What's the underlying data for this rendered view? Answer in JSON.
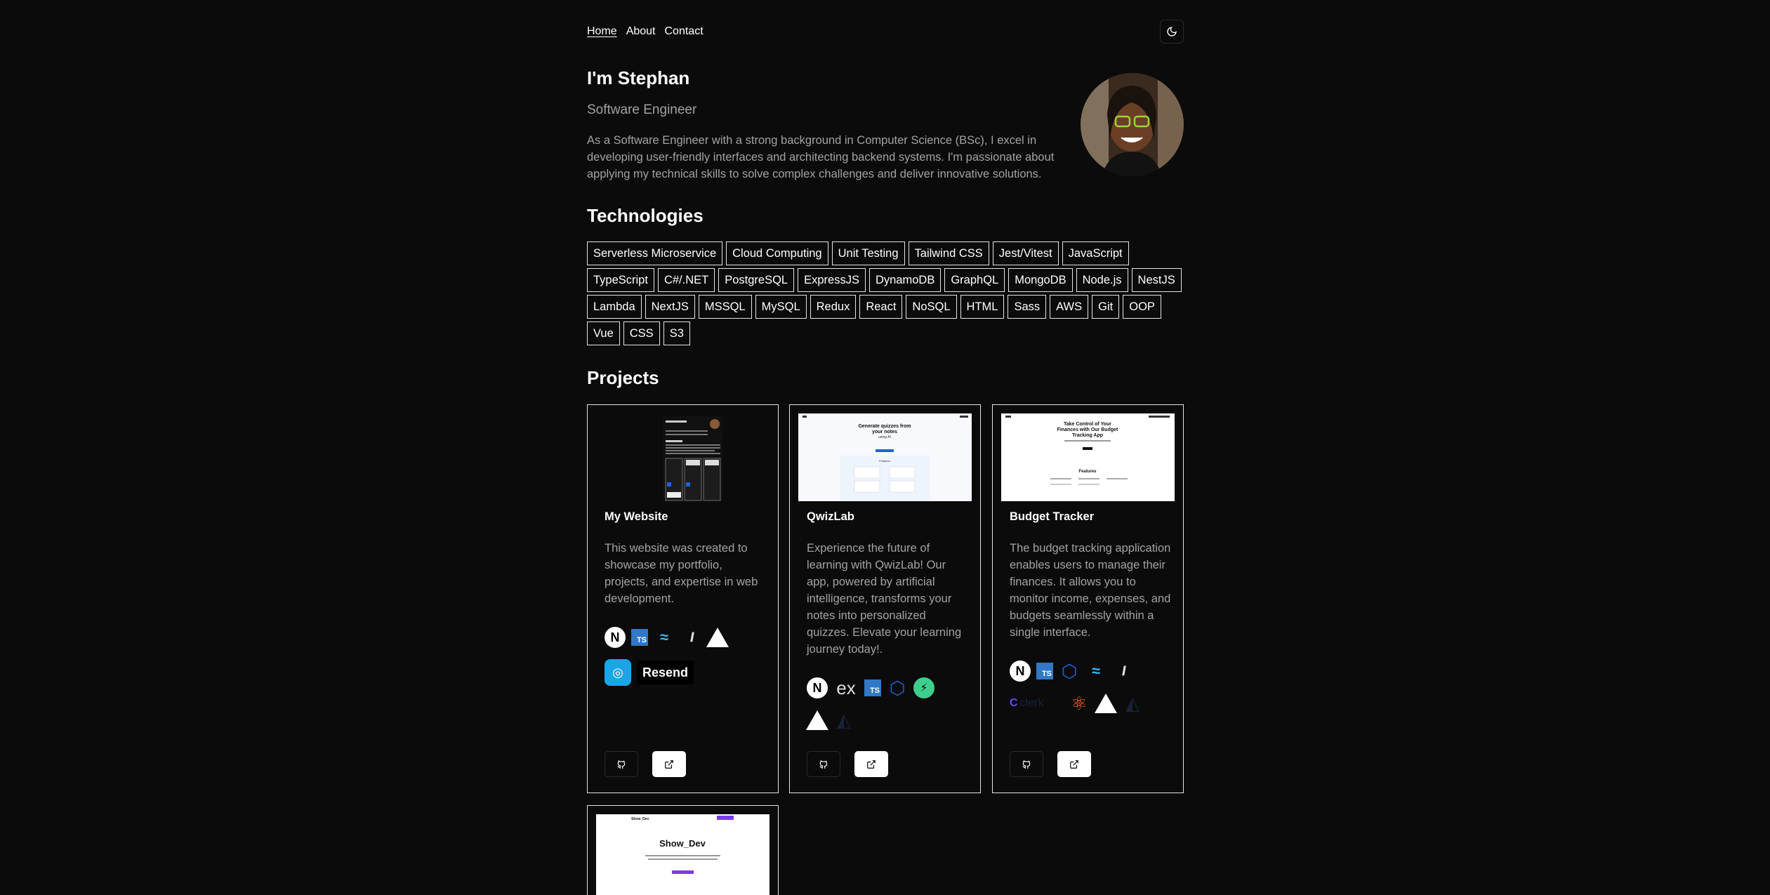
{
  "nav": {
    "items": [
      "Home",
      "About",
      "Contact"
    ]
  },
  "theme_toggle": {
    "icon": "moon-icon"
  },
  "hero": {
    "name": "I'm Stephan",
    "role": "Software Engineer",
    "bio": "As a Software Engineer with a strong background in Computer Science (BSc), I excel in developing user-friendly interfaces and architecting backend systems. I'm passionate about applying my technical skills to solve complex challenges and deliver innovative solutions."
  },
  "technologies": {
    "title": "Technologies",
    "tags": [
      "Serverless Microservice",
      "Cloud Computing",
      "Unit Testing",
      "Tailwind CSS",
      "Jest/Vitest",
      "JavaScript",
      "TypeScript",
      "C#/.NET",
      "PostgreSQL",
      "ExpressJS",
      "DynamoDB",
      "GraphQL",
      "MongoDB",
      "Node.js",
      "NestJS",
      "Lambda",
      "NextJS",
      "MSSQL",
      "MySQL",
      "Redux",
      "React",
      "NoSQL",
      "HTML",
      "Sass",
      "AWS",
      "Git",
      "OOP",
      "Vue",
      "CSS",
      "S3"
    ]
  },
  "projects": {
    "title": "Projects",
    "cards": [
      {
        "title": "My Website",
        "description": "This website was created to showcase my portfolio, projects, and expertise in web development.",
        "stack_icons": [
          "nextjs-icon",
          "typescript-icon",
          "tailwind-icon",
          "shadcn-icon",
          "vercel-icon",
          "resend-logo-icon"
        ],
        "resend_label": "Resend"
      },
      {
        "title": "QwizLab",
        "description": "Experience the future of learning with QwizLab! Our app, powered by artificial intelligence, transforms your notes into personalized quizzes. Elevate your learning journey today!.",
        "stack_icons": [
          "nextjs-icon",
          "express-icon",
          "typescript-icon",
          "graphql-icon",
          "supabase-icon",
          "vercel-icon",
          "prisma-icon"
        ],
        "express_label": "ex"
      },
      {
        "title": "Budget Tracker",
        "description": "The budget tracking application enables users to manage their finances. It allows you to monitor income, expenses, and budgets seamlessly within a single interface.",
        "stack_icons": [
          "nextjs-icon",
          "typescript-icon",
          "graphql-icon",
          "tailwind-icon",
          "shadcn-icon",
          "clerk-icon",
          "react-icon",
          "vercel-icon",
          "prisma-icon"
        ],
        "clerk_label": "clerk"
      },
      {
        "title": "Show_Dev",
        "thumb_title": "Show_Dev"
      }
    ],
    "thumb_texts": {
      "qwizlab_heading": "Generate quizzes from your notes using AI",
      "qwizlab_sub": "Features",
      "budget_heading": "Take Control of Your Finances with Our Budget Tracking App",
      "budget_sub": "Features"
    }
  }
}
